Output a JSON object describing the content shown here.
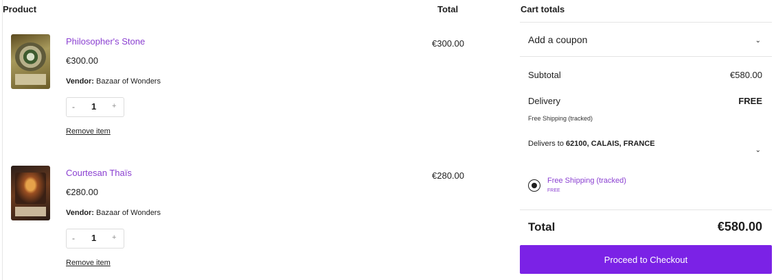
{
  "table": {
    "headers": {
      "product": "Product",
      "total": "Total"
    }
  },
  "items": [
    {
      "name": "Philosopher's Stone",
      "price": "€300.00",
      "vendor_label": "Vendor:",
      "vendor": "Bazaar of Wonders",
      "quantity": "1",
      "minus": "-",
      "plus": "+",
      "remove": "Remove item",
      "line_total": "€300.00"
    },
    {
      "name": "Courtesan Thaïs",
      "price": "€280.00",
      "vendor_label": "Vendor:",
      "vendor": "Bazaar of Wonders",
      "quantity": "1",
      "minus": "-",
      "plus": "+",
      "remove": "Remove item",
      "line_total": "€280.00"
    }
  ],
  "cart_totals": {
    "title": "Cart totals",
    "coupon": "Add a coupon",
    "subtotal_label": "Subtotal",
    "subtotal_value": "€580.00",
    "delivery_label": "Delivery",
    "delivery_value": "FREE",
    "delivery_method": "Free Shipping (tracked)",
    "delivers_to_prefix": "Delivers to",
    "delivers_to": "62100, CALAIS, FRANCE",
    "shipping_option": "Free Shipping (tracked)",
    "shipping_option_price": "FREE",
    "total_label": "Total",
    "total_value": "€580.00",
    "checkout_label": "Proceed to Checkout"
  },
  "colors": {
    "accent": "#7b22e6",
    "link": "#8a3fd1"
  },
  "icons": [
    "chevron-down-icon",
    "radio-selected-icon"
  ]
}
